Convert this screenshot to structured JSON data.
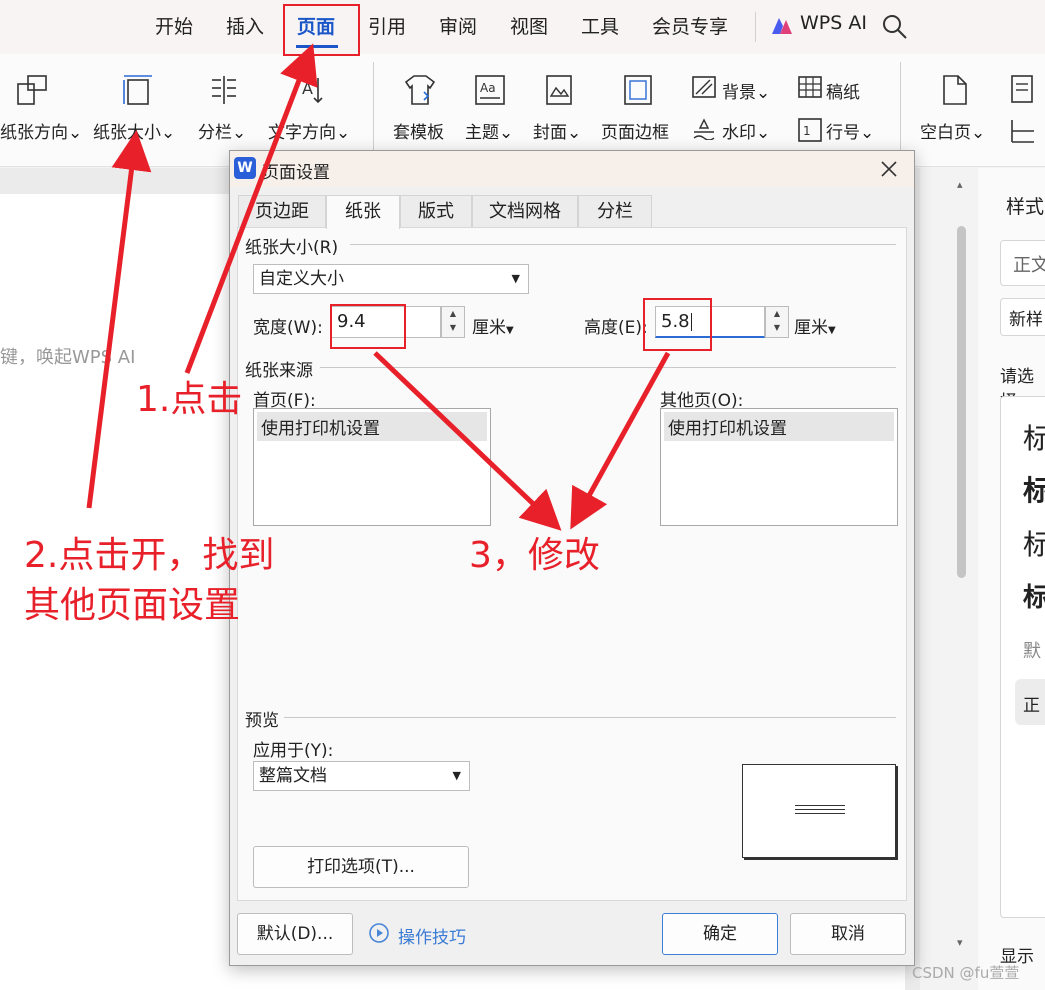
{
  "menu": {
    "items": [
      "开始",
      "插入",
      "页面",
      "引用",
      "审阅",
      "视图",
      "工具",
      "会员专享"
    ],
    "active": "页面",
    "wps_ai": "WPS AI"
  },
  "ribbon": {
    "paper_direction": "纸张方向",
    "paper_size": "纸张大小",
    "columns": "分栏",
    "text_direction": "文字方向",
    "template": "套模板",
    "theme": "主题",
    "cover": "封面",
    "page_border": "页面边框",
    "background": "背景",
    "watermark": "水印",
    "manuscript": "稿纸",
    "line_number": "行号",
    "blank_page": "空白页"
  },
  "document": {
    "hint_text": "键，唤起WPS AI"
  },
  "right_panel": {
    "title": "样式",
    "box1": "正文",
    "box2": "新样",
    "prompt": "请选择",
    "styles": [
      "标",
      "标",
      "标",
      "标"
    ],
    "default": "默",
    "current": "正",
    "show": "显示"
  },
  "dialog": {
    "title": "页面设置",
    "tabs": [
      "页边距",
      "纸张",
      "版式",
      "文档网格",
      "分栏"
    ],
    "active_tab": "纸张",
    "paper_size_group": "纸张大小(R)",
    "paper_size_value": "自定义大小",
    "width_label": "宽度(W):",
    "width_value": "9.4",
    "width_unit": "厘米",
    "height_label": "高度(E):",
    "height_value": "5.8",
    "height_unit": "厘米",
    "source_group": "纸张来源",
    "first_page_label": "首页(F):",
    "first_page_value": "使用打印机设置",
    "other_pages_label": "其他页(O):",
    "other_pages_value": "使用打印机设置",
    "preview_group": "预览",
    "apply_to_label": "应用于(Y):",
    "apply_to_value": "整篇文档",
    "print_options": "打印选项(T)...",
    "default_button": "默认(D)...",
    "tips_link": "操作技巧",
    "ok": "确定",
    "cancel": "取消"
  },
  "annotations": {
    "step1": "1.点击",
    "step2_line1": "2.点击开，找到",
    "step2_line2": "其他页面设置",
    "step3": "3，修改"
  },
  "watermark": "CSDN @fu萱萱",
  "colors": {
    "accent": "#1a56c8",
    "annotation": "#e8202a"
  }
}
